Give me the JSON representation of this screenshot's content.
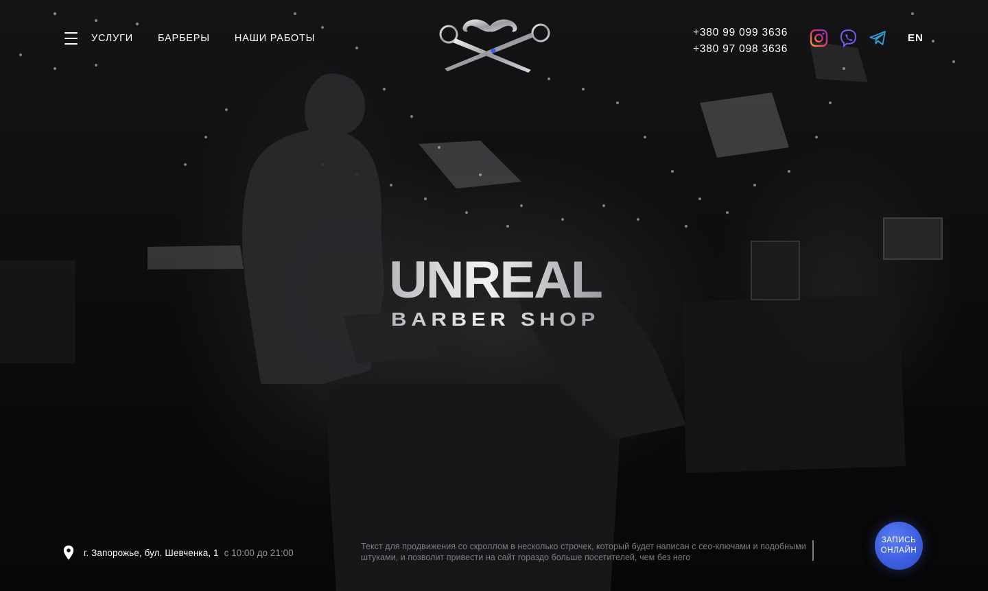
{
  "header": {
    "menu_icon": "hamburger-icon",
    "nav": [
      {
        "label": "УСЛУГИ"
      },
      {
        "label": "БАРБЕРЫ"
      },
      {
        "label": "НАШИ РАБОТЫ"
      }
    ],
    "logo_icon": "mustache-scissors-logo",
    "phones": [
      "+380 99 099 3636",
      "+380 97 098 3636"
    ],
    "socials": [
      {
        "icon": "instagram-icon",
        "color": "#c13584"
      },
      {
        "icon": "viber-icon",
        "color": "#7360f2"
      },
      {
        "icon": "telegram-icon",
        "color": "#2ea6db"
      }
    ],
    "language": "EN"
  },
  "brand": {
    "name": "UNREAL",
    "subtitle": "BARBER SHOP"
  },
  "footer": {
    "pin_icon": "location-pin-icon",
    "address": "г. Запорожье, бул. Шевченка, 1",
    "hours": "с 10:00 до 21:00",
    "seo_text": "Текст для продвижения со скроллом в несколько строчек, который будет написан с сео-ключами и подобными штуками, и позволит привести на сайт гораздо больше посетителей, чем без него",
    "book_line1": "ЗАПИСЬ",
    "book_line2": "ОНЛАЙН",
    "accent": "#3d5fe0"
  }
}
